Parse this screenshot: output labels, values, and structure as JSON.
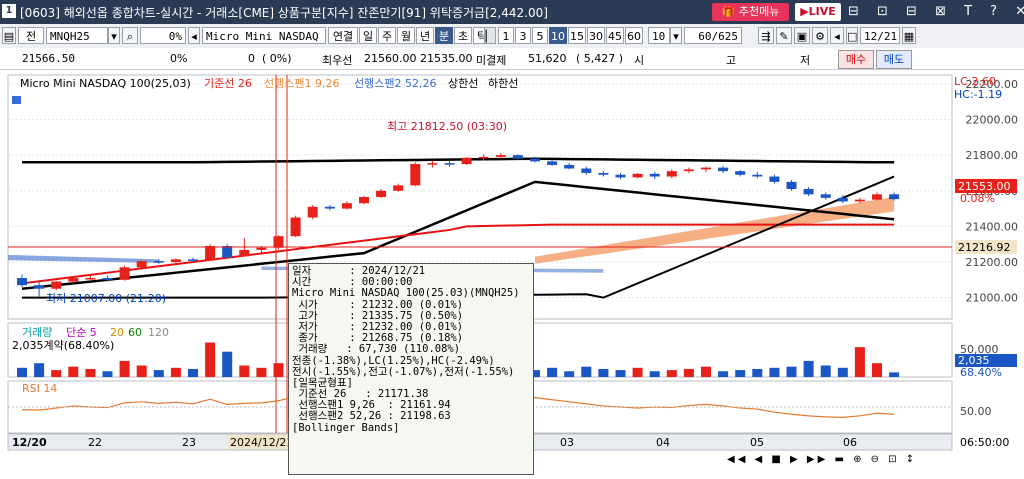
{
  "window": {
    "num": "1",
    "title": "[0603] 해외선옵 종합차트-실시간 - 거래소[CME] 상품구분[지수] 잔존만기[91] 위탁증거금[2,442.00]",
    "recommend_menu": "추천메뉴",
    "live": "LIVE",
    "controls": "⊟ ⊡ ⊟ ⊠ T ? ✕"
  },
  "toolbar": {
    "all": "전",
    "symbol_code": "MNQH25",
    "rate_field": "0%",
    "amount_field": "0",
    "product_name": "Micro Mini NASDAQ 100",
    "periods": [
      "연결",
      "일",
      "주",
      "월",
      "년",
      "분",
      "초",
      "틱"
    ],
    "selected_period": "분",
    "intervals": [
      "1",
      "3",
      "5",
      "10",
      "15",
      "30",
      "45",
      "60"
    ],
    "selected_interval": "10",
    "interval_select": "10",
    "count_field": "60/625",
    "date_field": "12/21"
  },
  "pricebar": {
    "current": "21566.50",
    "change_pct": "0%",
    "change_vol": "0",
    "diff": "( 0%)",
    "best_bid_label": "최우선",
    "best_bid": "21560.00",
    "best_ask": "21535.00",
    "open_int_label": "미결제",
    "open_int": "51,620",
    "open_int_chg": "( 5,427 )",
    "open_label": "시",
    "high_label": "고",
    "close_label": "저",
    "buy": "매수",
    "sell": "매도"
  },
  "chart": {
    "legend": {
      "name": "Micro Mini NASDAQ 100(25,03)",
      "base_line": "기준선 26",
      "span1": "선행스팬1 9,26",
      "span2": "선행스팬2 52,26",
      "upper": "상한선",
      "lower": "하한선"
    },
    "annotations": {
      "high_label": "최고 21812.50 (03:30)",
      "low_label": "최저 21007.00 (21:20)",
      "lc": "LC:2.60",
      "hc": "HC:-1.19"
    },
    "y_ticks": [
      "22200.00",
      "22000.00",
      "21800.00",
      "21600.00",
      "21400.00",
      "21200.00",
      "21000.00"
    ],
    "current_price_tag": "21553.00",
    "current_pct_tag": "0.08%",
    "crosshair_price_tag": "21216.92",
    "volume": {
      "label": "거래량",
      "ma": "단순 5",
      "ma20": "20",
      "ma60": "60",
      "ma120": "120",
      "contracts": "2,035계약(68.40%)",
      "y_tick": "50,000",
      "tag_value": "2,035",
      "tag_pct": "68.40%"
    },
    "rsi": {
      "label": "RSI 14",
      "y_tick": "50.00"
    },
    "x_labels": [
      "12/20",
      "22",
      "23",
      "2024/12/21",
      "03",
      "04",
      "05",
      "06"
    ],
    "time_tag": "06:50:00",
    "colors": {
      "up": "#e8201a",
      "down": "#1a56c4",
      "base": "#e81010",
      "span_band": "#f5a070",
      "band_blue": "#6b8fd8"
    }
  },
  "chart_data": {
    "type": "candlestick",
    "title": "Micro Mini NASDAQ 100(25,03)",
    "ylim": [
      20880,
      22250
    ],
    "candles": [
      {
        "o": 21110,
        "h": 21130,
        "l": 21060,
        "c": 21070
      },
      {
        "o": 21070,
        "h": 21090,
        "l": 21007,
        "c": 21050
      },
      {
        "o": 21050,
        "h": 21095,
        "l": 21040,
        "c": 21090
      },
      {
        "o": 21090,
        "h": 21120,
        "l": 21080,
        "c": 21110
      },
      {
        "o": 21110,
        "h": 21130,
        "l": 21100,
        "c": 21110
      },
      {
        "o": 21110,
        "h": 21125,
        "l": 21090,
        "c": 21100
      },
      {
        "o": 21100,
        "h": 21180,
        "l": 21095,
        "c": 21170
      },
      {
        "o": 21170,
        "h": 21210,
        "l": 21160,
        "c": 21205
      },
      {
        "o": 21205,
        "h": 21215,
        "l": 21190,
        "c": 21200
      },
      {
        "o": 21200,
        "h": 21220,
        "l": 21195,
        "c": 21215
      },
      {
        "o": 21215,
        "h": 21225,
        "l": 21200,
        "c": 21210
      },
      {
        "o": 21210,
        "h": 21300,
        "l": 21205,
        "c": 21290
      },
      {
        "o": 21290,
        "h": 21300,
        "l": 21220,
        "c": 21225
      },
      {
        "o": 21232,
        "h": 21335,
        "l": 21232,
        "c": 21268
      },
      {
        "o": 21268,
        "h": 21290,
        "l": 21250,
        "c": 21280
      },
      {
        "o": 21280,
        "h": 21350,
        "l": 21270,
        "c": 21345
      },
      {
        "o": 21345,
        "h": 21460,
        "l": 21340,
        "c": 21450
      },
      {
        "o": 21450,
        "h": 21520,
        "l": 21440,
        "c": 21510
      },
      {
        "o": 21510,
        "h": 21520,
        "l": 21490,
        "c": 21500
      },
      {
        "o": 21500,
        "h": 21540,
        "l": 21495,
        "c": 21530
      },
      {
        "o": 21530,
        "h": 21570,
        "l": 21525,
        "c": 21565
      },
      {
        "o": 21565,
        "h": 21610,
        "l": 21560,
        "c": 21600
      },
      {
        "o": 21600,
        "h": 21640,
        "l": 21595,
        "c": 21630
      },
      {
        "o": 21630,
        "h": 21760,
        "l": 21625,
        "c": 21750
      },
      {
        "o": 21750,
        "h": 21770,
        "l": 21730,
        "c": 21755
      },
      {
        "o": 21755,
        "h": 21765,
        "l": 21735,
        "c": 21750
      },
      {
        "o": 21750,
        "h": 21790,
        "l": 21745,
        "c": 21785
      },
      {
        "o": 21785,
        "h": 21805,
        "l": 21770,
        "c": 21790
      },
      {
        "o": 21790,
        "h": 21812,
        "l": 21780,
        "c": 21800
      },
      {
        "o": 21800,
        "h": 21805,
        "l": 21775,
        "c": 21780
      },
      {
        "o": 21780,
        "h": 21790,
        "l": 21760,
        "c": 21765
      },
      {
        "o": 21765,
        "h": 21770,
        "l": 21740,
        "c": 21745
      },
      {
        "o": 21745,
        "h": 21755,
        "l": 21720,
        "c": 21725
      },
      {
        "o": 21725,
        "h": 21735,
        "l": 21690,
        "c": 21700
      },
      {
        "o": 21700,
        "h": 21710,
        "l": 21680,
        "c": 21690
      },
      {
        "o": 21690,
        "h": 21700,
        "l": 21665,
        "c": 21675
      },
      {
        "o": 21675,
        "h": 21700,
        "l": 21670,
        "c": 21695
      },
      {
        "o": 21695,
        "h": 21705,
        "l": 21665,
        "c": 21680
      },
      {
        "o": 21680,
        "h": 21720,
        "l": 21670,
        "c": 21710
      },
      {
        "o": 21710,
        "h": 21730,
        "l": 21700,
        "c": 21720
      },
      {
        "o": 21720,
        "h": 21735,
        "l": 21705,
        "c": 21730
      },
      {
        "o": 21730,
        "h": 21740,
        "l": 21700,
        "c": 21710
      },
      {
        "o": 21710,
        "h": 21715,
        "l": 21680,
        "c": 21690
      },
      {
        "o": 21690,
        "h": 21705,
        "l": 21670,
        "c": 21680
      },
      {
        "o": 21680,
        "h": 21690,
        "l": 21640,
        "c": 21650
      },
      {
        "o": 21650,
        "h": 21660,
        "l": 21600,
        "c": 21610
      },
      {
        "o": 21610,
        "h": 21620,
        "l": 21570,
        "c": 21580
      },
      {
        "o": 21580,
        "h": 21590,
        "l": 21550,
        "c": 21560
      },
      {
        "o": 21560,
        "h": 21575,
        "l": 21530,
        "c": 21540
      },
      {
        "o": 21540,
        "h": 21560,
        "l": 21530,
        "c": 21550
      },
      {
        "o": 21550,
        "h": 21590,
        "l": 21545,
        "c": 21580
      },
      {
        "o": 21580,
        "h": 21590,
        "l": 21545,
        "c": 21553
      }
    ],
    "volume": [
      8,
      12,
      6,
      9,
      7,
      5,
      14,
      10,
      6,
      8,
      7,
      30,
      22,
      10,
      8,
      12,
      35,
      18,
      9,
      10,
      11,
      8,
      9,
      14,
      7,
      6,
      8,
      9,
      10,
      7,
      6,
      8,
      5,
      9,
      7,
      6,
      8,
      5,
      6,
      7,
      9,
      5,
      6,
      7,
      8,
      9,
      14,
      10,
      8,
      26,
      12,
      4
    ],
    "rsi": [
      45,
      44,
      48,
      52,
      50,
      49,
      58,
      60,
      57,
      59,
      56,
      65,
      55,
      57,
      58,
      62,
      70,
      72,
      70,
      71,
      73,
      74,
      75,
      78,
      76,
      74,
      75,
      76,
      77,
      72,
      68,
      64,
      60,
      56,
      52,
      50,
      48,
      50,
      49,
      53,
      55,
      52,
      48,
      46,
      40,
      36,
      33,
      31,
      30,
      33,
      38,
      36
    ]
  },
  "tooltip": {
    "lines": [
      "일자      : 2024/12/21",
      "시간      : 00:00:00",
      "Micro Mini NASDAQ 100(25.03)(MNQH25)",
      " 시가     : 21232.00 (0.01%)",
      " 고가     : 21335.75 (0.50%)",
      " 저가     : 21232.00 (0.01%)",
      " 종가     : 21268.75 (0.18%)",
      " 거래량   : 67,730 (110.08%)",
      "전종(-1.38%),LC(1.25%),HC(-2.49%)",
      "전시(-1.55%),전고(-1.07%),전저(-1.55%)",
      "[일목균형표]",
      " 기준선 26   : 21171.38",
      " 선행스팬1 9,26  : 21161.94",
      " 선행스팬2 52,26 : 21198.63",
      "[Bollinger Bands]"
    ]
  },
  "bottom_nav": "◀◀ ◀ ■ ▶ ▶▶ ▬ ⊕ ⊖ ⊡ ↕"
}
